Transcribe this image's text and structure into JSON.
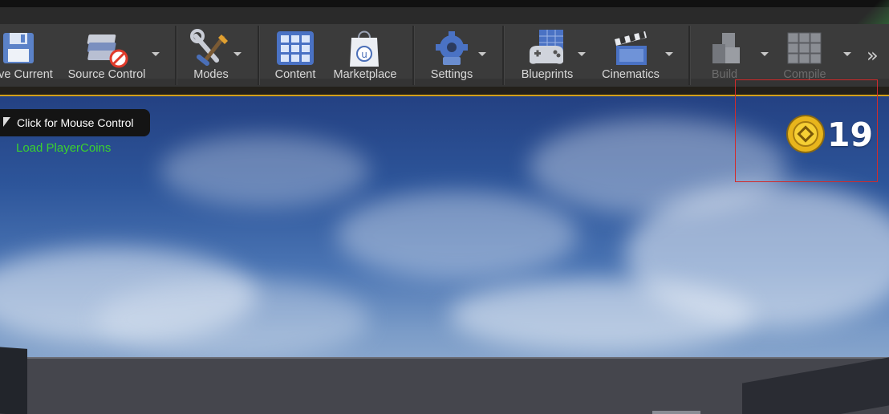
{
  "toolbar": {
    "buttons": [
      {
        "label": "ve Current",
        "icon": "floppy-disk-icon"
      },
      {
        "label": "Source Control",
        "icon": "source-control-icon"
      },
      {
        "label": "Modes",
        "icon": "tools-icon"
      },
      {
        "label": "Content",
        "icon": "content-grid-icon"
      },
      {
        "label": "Marketplace",
        "icon": "marketplace-bag-icon"
      },
      {
        "label": "Settings",
        "icon": "gear-icon"
      },
      {
        "label": "Blueprints",
        "icon": "gamepad-icon"
      },
      {
        "label": "Cinematics",
        "icon": "clapperboard-icon"
      },
      {
        "label": "Build",
        "icon": "build-blocks-icon",
        "disabled": true
      },
      {
        "label": "Compile",
        "icon": "compile-cubes-icon",
        "disabled": true
      }
    ],
    "overflow_icon": "double-chevron-right-icon"
  },
  "viewport": {
    "hint_text": "Click for Mouse Control",
    "debug_message": "Load PlayerCoins",
    "debug_color": "#3ad22e",
    "coin_icon": "gold-coin-icon",
    "coin_count": "19"
  },
  "colors": {
    "toolbar_bg": "#3b3b3b",
    "label": "#d8d8d8",
    "disabled_label": "#6c6c6c",
    "selection_outline": "#d02c2c",
    "viewport_border": "#d4a01a"
  }
}
